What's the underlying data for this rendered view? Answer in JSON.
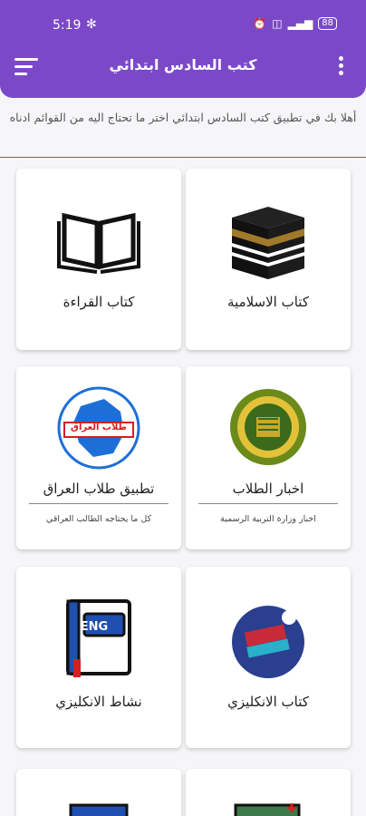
{
  "status_bar": {
    "time": "5:19",
    "battery": "88"
  },
  "app_bar": {
    "title": "كتب السادس ابتدائي"
  },
  "intro_text": "أهلا بك في تطبيق كتب السادس ابتدائي اختر ما تحتاج اليه من القوائم ادناه",
  "cards": [
    {
      "title": "كتاب الاسلامية",
      "icon": "kaaba-icon"
    },
    {
      "title": "كتاب القراءة",
      "icon": "open-book-icon"
    },
    {
      "title": "اخبار الطلاب",
      "subtitle": "اخبار وزارة التربية الرسمية",
      "icon": "ministry-emblem-icon"
    },
    {
      "title": "تطبيق طلاب العراق",
      "subtitle": "كل ما يحتاجه الطالب العراقي",
      "icon": "iraq-map-logo-icon",
      "logo_text": "طلاب العراق"
    },
    {
      "title": "كتاب الانكليزي",
      "icon": "english-books-icon"
    },
    {
      "title": "نشاط الانكليزي",
      "icon": "eng-book-icon",
      "badge": "ENG"
    },
    {
      "title": "",
      "icon": "math-board-icon"
    },
    {
      "title": "",
      "icon": "computer-icon"
    }
  ],
  "colors": {
    "primary": "#7b49c8",
    "background": "#f6f6f8"
  }
}
